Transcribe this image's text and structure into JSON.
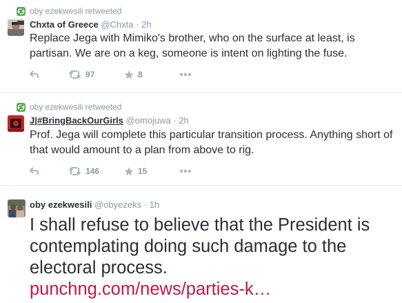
{
  "tweets": [
    {
      "context": "oby ezekwesili retweeted",
      "name": "Chxta of Greece",
      "handle": "@Chxta",
      "time": "2h",
      "text": "Replace Jega with Mimiko's brother, who on the surface at least, is partisan. We are on a keg, someone is intent on lighting the fuse.",
      "retweets": "97",
      "favorites": "8"
    },
    {
      "context": "oby ezekwesili retweeted",
      "name": "J|#BringBackOurGirls",
      "handle": "@omojuwa",
      "time": "2h",
      "text": "Prof. Jega will complete this particular transition process. Anything short of that would amount to a plan from above to rig.",
      "retweets": "146",
      "favorites": "15"
    },
    {
      "name": "oby ezekwesili",
      "handle": "@obyezeks",
      "time": "1h",
      "text": "I shall refuse to believe that the President is contemplating doing such damage to the electoral process.",
      "link": "punchng.com/news/parties-k…"
    }
  ],
  "separator": "·",
  "icons": {
    "retweeted_badge": "retweet-badge-icon",
    "reply": "reply-icon",
    "retweet": "retweet-icon",
    "favorite": "star-icon",
    "more": "more-icon"
  },
  "colors": {
    "text": "#292f33",
    "meta": "#8899a6",
    "link": "#c2174a",
    "retweet_badge": "#5ea85a"
  }
}
